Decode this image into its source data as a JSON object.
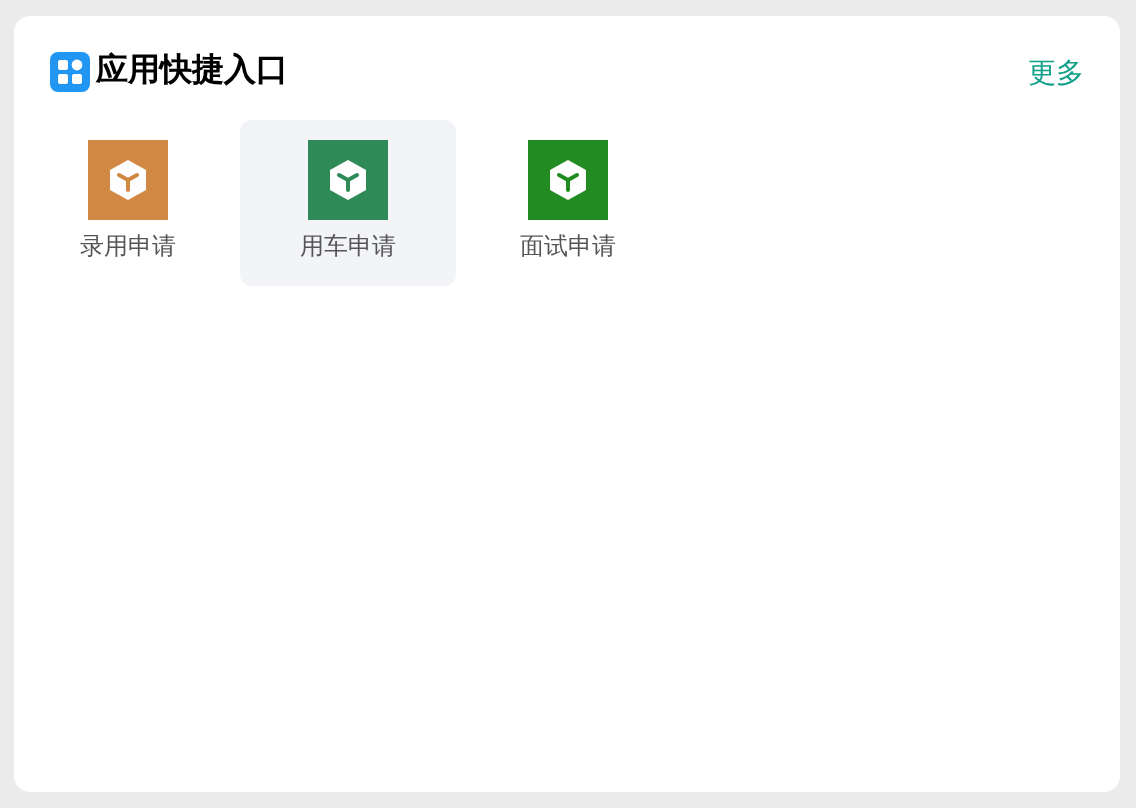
{
  "card": {
    "title": "应用快捷入口",
    "more_link": "更多"
  },
  "apps": [
    {
      "label": "录用申请",
      "color": "#d08842",
      "selected": false
    },
    {
      "label": "用车申请",
      "color": "#2e8b57",
      "selected": true
    },
    {
      "label": "面试申请",
      "color": "#228b22",
      "selected": false
    }
  ]
}
